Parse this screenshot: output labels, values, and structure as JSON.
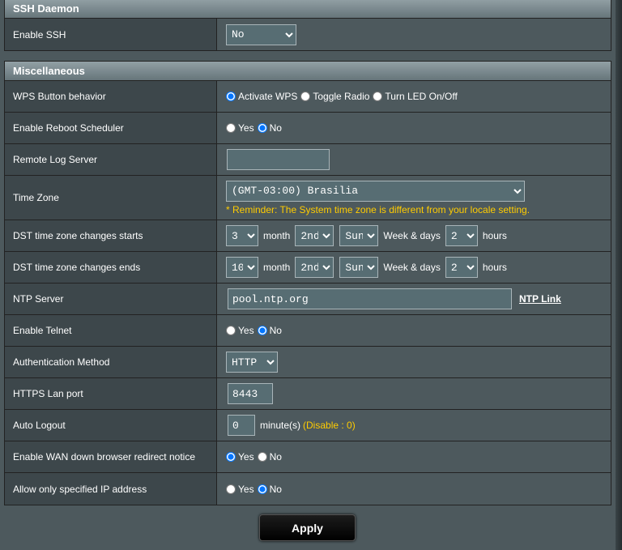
{
  "ssh": {
    "header": "SSH Daemon",
    "enable_label": "Enable SSH",
    "enable_value": "No"
  },
  "misc": {
    "header": "Miscellaneous",
    "wps": {
      "label": "WPS Button behavior",
      "opt1": "Activate WPS",
      "opt2": "Toggle Radio",
      "opt3": "Turn LED On/Off"
    },
    "reboot": {
      "label": "Enable Reboot Scheduler",
      "yes": "Yes",
      "no": "No"
    },
    "remote_log": {
      "label": "Remote Log Server",
      "value": ""
    },
    "timezone": {
      "label": "Time Zone",
      "value": "(GMT-03:00) Brasilia",
      "reminder": "* Reminder: The System time zone is different from your locale setting."
    },
    "dst_start": {
      "label": "DST time zone changes starts",
      "month": "3",
      "month_txt": "month",
      "week": "2nd",
      "day": "Sun",
      "wd_txt": "Week & days",
      "hour": "2",
      "hours_txt": "hours"
    },
    "dst_end": {
      "label": "DST time zone changes ends",
      "month": "10",
      "month_txt": "month",
      "week": "2nd",
      "day": "Sun",
      "wd_txt": "Week & days",
      "hour": "2",
      "hours_txt": "hours"
    },
    "ntp": {
      "label": "NTP Server",
      "value": "pool.ntp.org",
      "link": "NTP Link"
    },
    "telnet": {
      "label": "Enable Telnet",
      "yes": "Yes",
      "no": "No"
    },
    "auth": {
      "label": "Authentication Method",
      "value": "HTTP"
    },
    "https_port": {
      "label": "HTTPS Lan port",
      "value": "8443"
    },
    "logout": {
      "label": "Auto Logout",
      "value": "0",
      "unit": "minute(s)",
      "note": "(Disable : 0)"
    },
    "wan_redirect": {
      "label": "Enable WAN down browser redirect notice",
      "yes": "Yes",
      "no": "No"
    },
    "allow_ip": {
      "label": "Allow only specified IP address",
      "yes": "Yes",
      "no": "No"
    }
  },
  "apply_label": "Apply"
}
